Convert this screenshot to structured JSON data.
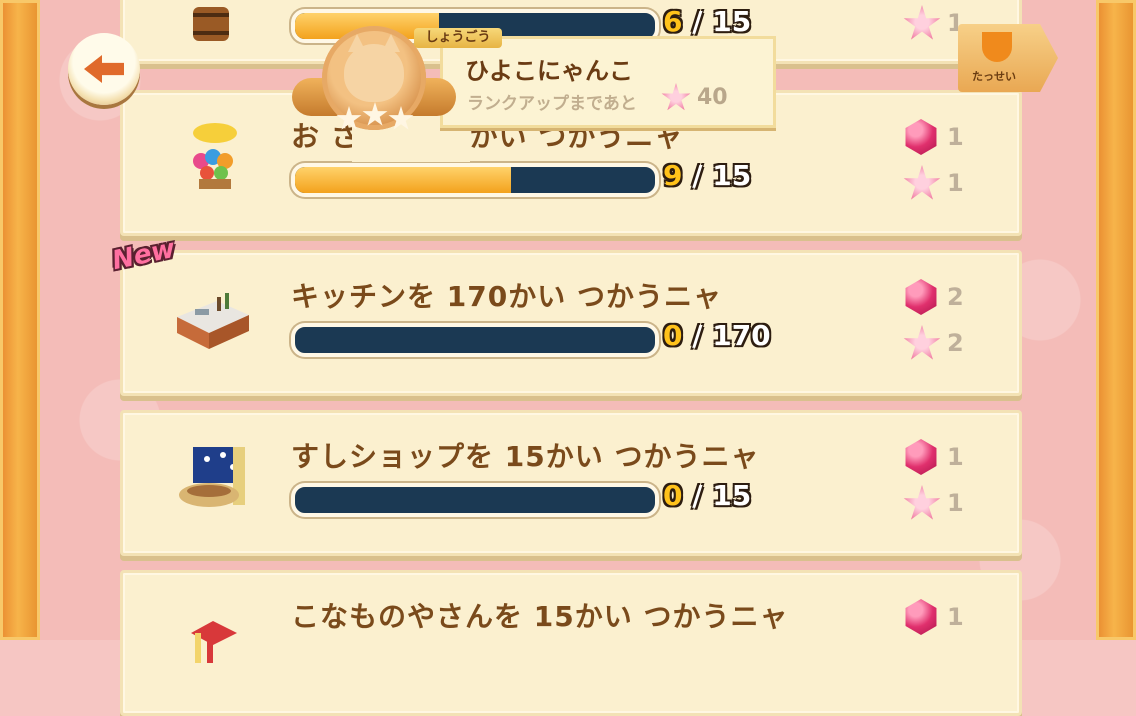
{
  "header": {
    "rank_tag": "しょうごう",
    "rank_name": "ひよこにゃんこ",
    "next_rank_text": "ランクアップまであと",
    "next_rank_points": "40",
    "achievements_label": "たっせい"
  },
  "new_badge": "New",
  "missions": [
    {
      "title": "",
      "current": "6",
      "total": "15",
      "progress": 0.4,
      "gems": "",
      "stars": "1"
    },
    {
      "title": "お   さんを 15かい つかうニャ",
      "current": "9",
      "total": "15",
      "progress": 0.6,
      "gems": "1",
      "stars": "1"
    },
    {
      "title": "キッチンを 170かい つかうニャ",
      "current": "0",
      "total": "170",
      "progress": 0.0,
      "gems": "2",
      "stars": "2"
    },
    {
      "title": "すしショップを 15かい つかうニャ",
      "current": "0",
      "total": "15",
      "progress": 0.0,
      "gems": "1",
      "stars": "1"
    },
    {
      "title": "こなものやさんを 15かい つかうニャ",
      "current": "",
      "total": "",
      "progress": 0.0,
      "gems": "1",
      "stars": ""
    }
  ],
  "colors": {
    "title_text": "#7a4a1b",
    "bar_fill": "#f3a21d",
    "bar_empty": "#1b3953",
    "gem": "#e0306d",
    "star": "#f07aa0"
  }
}
